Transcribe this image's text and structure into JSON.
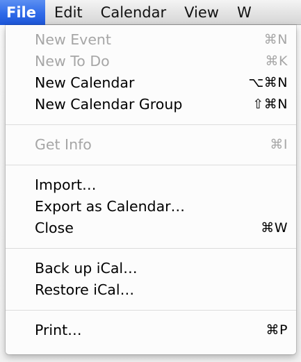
{
  "menubar": {
    "items": [
      {
        "label": "File",
        "active": true
      },
      {
        "label": "Edit",
        "active": false
      },
      {
        "label": "Calendar",
        "active": false
      },
      {
        "label": "View",
        "active": false
      },
      {
        "label": "W",
        "active": false
      }
    ]
  },
  "file_menu": {
    "groups": [
      [
        {
          "label": "New Event",
          "shortcut": "⌘N",
          "enabled": false
        },
        {
          "label": "New To Do",
          "shortcut": "⌘K",
          "enabled": false
        },
        {
          "label": "New Calendar",
          "shortcut": "⌥⌘N",
          "enabled": true
        },
        {
          "label": "New Calendar Group",
          "shortcut": "⇧⌘N",
          "enabled": true
        }
      ],
      [
        {
          "label": "Get Info",
          "shortcut": "⌘I",
          "enabled": false
        }
      ],
      [
        {
          "label": "Import…",
          "shortcut": "",
          "enabled": true
        },
        {
          "label": "Export as Calendar…",
          "shortcut": "",
          "enabled": true
        },
        {
          "label": "Close",
          "shortcut": "⌘W",
          "enabled": true
        }
      ],
      [
        {
          "label": "Back up iCal…",
          "shortcut": "",
          "enabled": true
        },
        {
          "label": "Restore iCal…",
          "shortcut": "",
          "enabled": true
        }
      ],
      [
        {
          "label": "Print…",
          "shortcut": "⌘P",
          "enabled": true
        }
      ]
    ]
  },
  "colors": {
    "menubar_highlight": "#2f6ae8",
    "disabled_text": "#a6a6a6",
    "enabled_text": "#000000"
  }
}
